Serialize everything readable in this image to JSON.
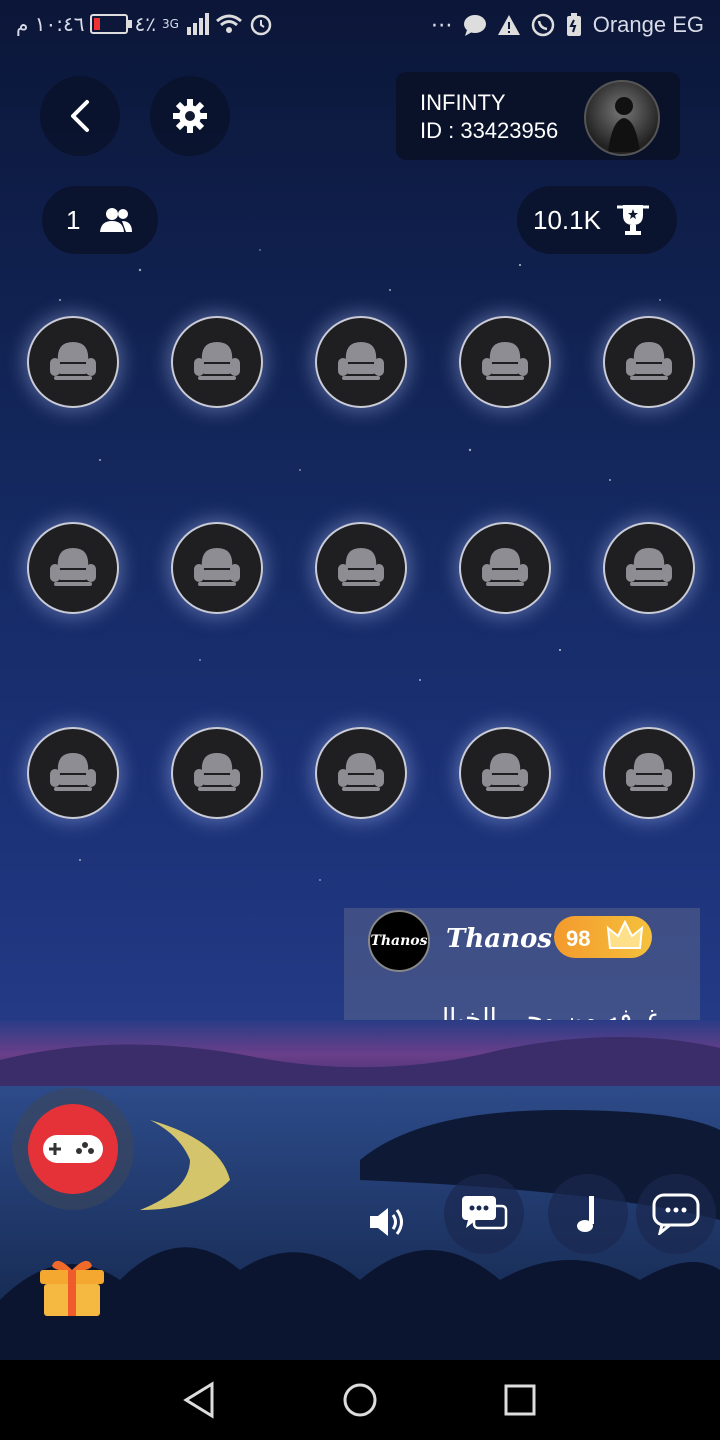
{
  "status_bar": {
    "time": "١٠:٤٦ م",
    "battery_percent": "٤٪",
    "network": "3G",
    "carrier": "Orange EG"
  },
  "header": {
    "profile_name": "INFINTY",
    "profile_id": "ID : 33423956"
  },
  "stats": {
    "online_count": "1",
    "trophy_score": "10.1K"
  },
  "seats": {
    "rows": 3,
    "columns": 5,
    "icon": "armchair-icon"
  },
  "message": {
    "sender_avatar_text": "Thanos",
    "sender_name": "Thanos",
    "level": "98",
    "text": "غرفه من وحي الخيال"
  },
  "controls": {
    "icons": [
      "gamepad-icon",
      "speaker-icon",
      "chat-bubbles-icon",
      "music-note-icon",
      "comment-icon",
      "gift-icon"
    ]
  },
  "colors": {
    "background_top": "#0b1638",
    "seat_fill": "#1f1f22",
    "game_button": "#e53238",
    "level_badge": "#f5a830"
  }
}
